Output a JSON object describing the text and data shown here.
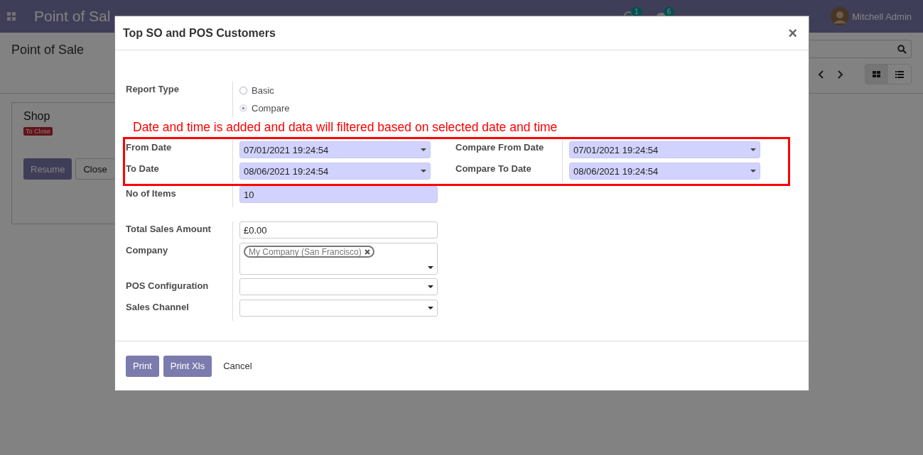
{
  "background": {
    "app_name": "Point of Sal",
    "activity_count": "1",
    "message_count": "6",
    "user": "Mitchell Admin",
    "breadcrumb": "Point of Sale",
    "card": {
      "title": "Shop",
      "status": "To Close",
      "buttons": [
        {
          "label": "Resume",
          "kind": "primary"
        },
        {
          "label": "Close",
          "kind": "secondary"
        }
      ]
    }
  },
  "dialog": {
    "title": "Top SO and POS Customers",
    "close": "×",
    "report_type": {
      "label": "Report Type",
      "options": [
        {
          "label": "Basic",
          "selected": false
        },
        {
          "label": "Compare",
          "selected": true
        }
      ]
    },
    "annotation": "Date and time is added and data will filtered based on selected date and time",
    "dates": [
      {
        "label": "From Date",
        "value": "07/01/2021 19:24:54",
        "compare_label": "Compare From Date",
        "compare_value": "07/01/2021 19:24:54"
      },
      {
        "label": "To Date",
        "value": "08/06/2021 19:24:54",
        "compare_label": "Compare To Date",
        "compare_value": "08/06/2021 19:24:54"
      }
    ],
    "fields": [
      {
        "label": "No of Items",
        "kind": "required",
        "value": "10"
      },
      {
        "label": "Total Sales Amount",
        "kind": "text",
        "value": "£0.00"
      },
      {
        "label": "Company",
        "kind": "tags",
        "tags": [
          "My Company (San Francisco)"
        ]
      },
      {
        "label": "POS Configuration",
        "kind": "select"
      },
      {
        "label": "Sales Channel",
        "kind": "select"
      }
    ],
    "buttons": [
      {
        "label": "Print",
        "kind": "primary"
      },
      {
        "label": "Print Xls",
        "kind": "primary"
      },
      {
        "label": "Cancel",
        "kind": "link"
      }
    ]
  }
}
